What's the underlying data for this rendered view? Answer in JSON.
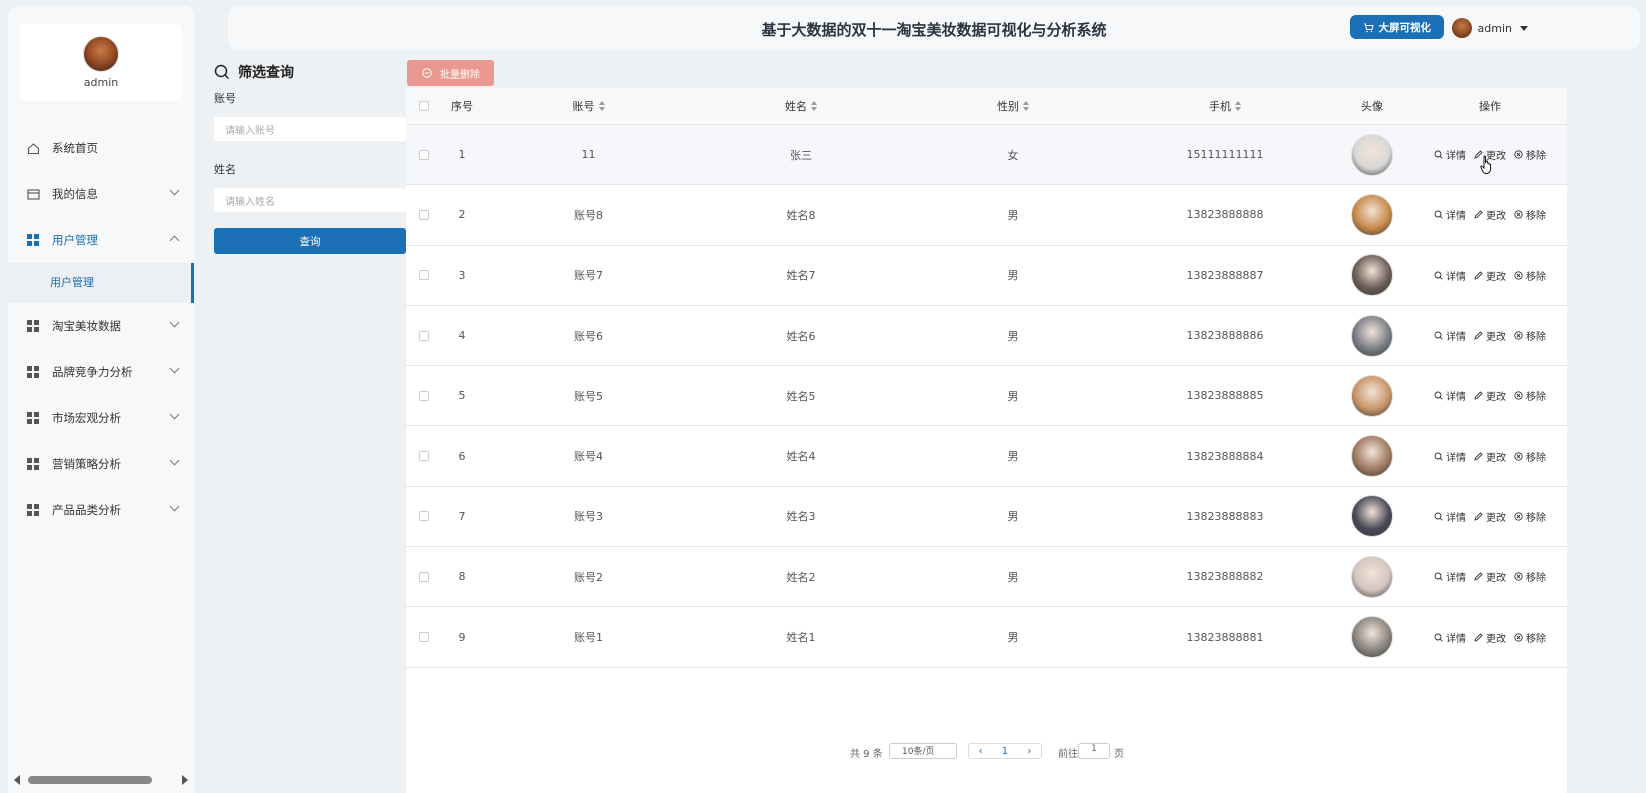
{
  "sidebar": {
    "username": "admin",
    "menu": [
      {
        "label": "系统首页",
        "icon": "home-icon"
      },
      {
        "label": "我的信息",
        "icon": "card-icon"
      },
      {
        "label": "用户管理",
        "icon": "grid-icon",
        "expanded": true,
        "children": [
          "用户管理"
        ]
      },
      {
        "label": "淘宝美妆数据",
        "icon": "grid-icon"
      },
      {
        "label": "品牌竞争力分析",
        "icon": "grid-icon"
      },
      {
        "label": "市场宏观分析",
        "icon": "grid-icon"
      },
      {
        "label": "营销策略分析",
        "icon": "grid-icon"
      },
      {
        "label": "产品品类分析",
        "icon": "grid-icon"
      }
    ]
  },
  "header": {
    "title": "基于大数据的双十一淘宝美妆数据可视化与分析系统",
    "bigscreen_label": "大屏可视化",
    "user": "admin"
  },
  "filter": {
    "title": "筛选查询",
    "account_label": "账号",
    "account_placeholder": "请输入账号",
    "name_label": "姓名",
    "name_placeholder": "请输入姓名",
    "query_label": "查询"
  },
  "toolbar": {
    "batch_delete_label": "批量删除"
  },
  "table": {
    "headers": {
      "index": "序号",
      "account": "账号",
      "name": "姓名",
      "sex": "性别",
      "phone": "手机",
      "avatar": "头像",
      "ops": "操作"
    },
    "ops_labels": {
      "detail": "详情",
      "edit": "更改",
      "remove": "移除"
    },
    "rows": [
      {
        "index": "1",
        "account": "11",
        "name": "张三",
        "sex": "女",
        "phone": "15111111111",
        "avatar_color": "#d8d8d8"
      },
      {
        "index": "2",
        "account": "账号8",
        "name": "姓名8",
        "sex": "男",
        "phone": "13823888888",
        "avatar_color": "#c98a4a"
      },
      {
        "index": "3",
        "account": "账号7",
        "name": "姓名7",
        "sex": "男",
        "phone": "13823888887",
        "avatar_color": "#6b5e58"
      },
      {
        "index": "4",
        "account": "账号6",
        "name": "姓名6",
        "sex": "男",
        "phone": "13823888886",
        "avatar_color": "#7a7f86"
      },
      {
        "index": "5",
        "account": "账号5",
        "name": "姓名5",
        "sex": "男",
        "phone": "13823888885",
        "avatar_color": "#c8956a"
      },
      {
        "index": "6",
        "account": "账号4",
        "name": "姓名4",
        "sex": "男",
        "phone": "13823888884",
        "avatar_color": "#a07a62"
      },
      {
        "index": "7",
        "account": "账号3",
        "name": "姓名3",
        "sex": "男",
        "phone": "13823888883",
        "avatar_color": "#4a4a58"
      },
      {
        "index": "8",
        "account": "账号2",
        "name": "姓名2",
        "sex": "男",
        "phone": "13823888882",
        "avatar_color": "#d6c4c0"
      },
      {
        "index": "9",
        "account": "账号1",
        "name": "姓名1",
        "sex": "男",
        "phone": "13823888881",
        "avatar_color": "#8a8580"
      }
    ]
  },
  "pagination": {
    "total": "共 9 条",
    "page_size": "10条/页",
    "current": "1",
    "jump_prefix": "前往",
    "jump_value": "1",
    "jump_suffix": "页"
  },
  "colors": {
    "primary": "#1a6fb5",
    "danger_light": "#e8988e"
  }
}
